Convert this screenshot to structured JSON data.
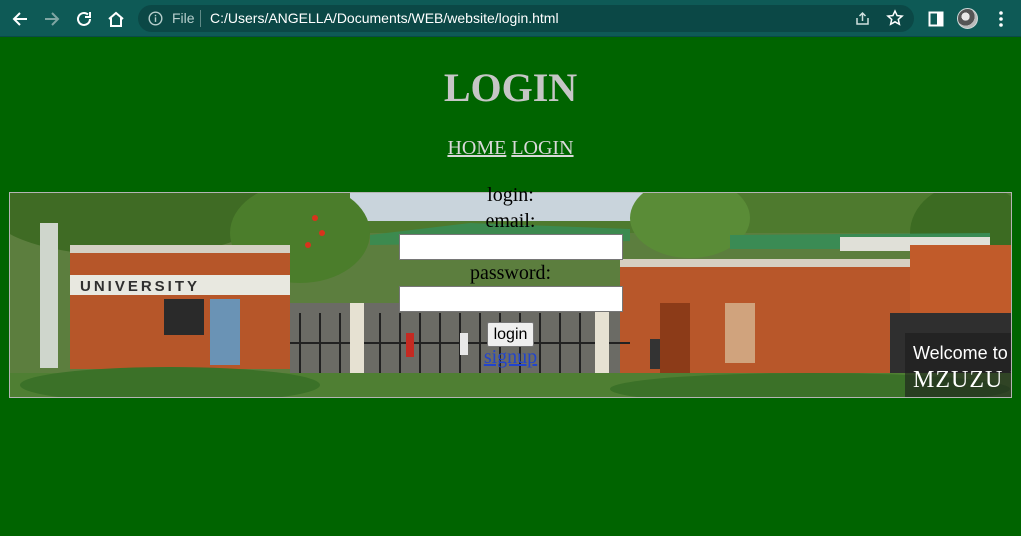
{
  "browser": {
    "file_label": "File",
    "url": "C:/Users/ANGELLA/Documents/WEB/website/login.html"
  },
  "page": {
    "title": "LOGIN",
    "nav": [
      "HOME",
      "LOGIN"
    ]
  },
  "form": {
    "login_label": "login:",
    "email_label": "email:",
    "email_value": "",
    "password_label": "password:",
    "password_value": "",
    "submit_label": "login",
    "signup_label": "signup"
  },
  "banner": {
    "sign_text": "UNIVERSITY",
    "welcome_line1": "Welcome to",
    "welcome_line2": "MZUZU U"
  }
}
